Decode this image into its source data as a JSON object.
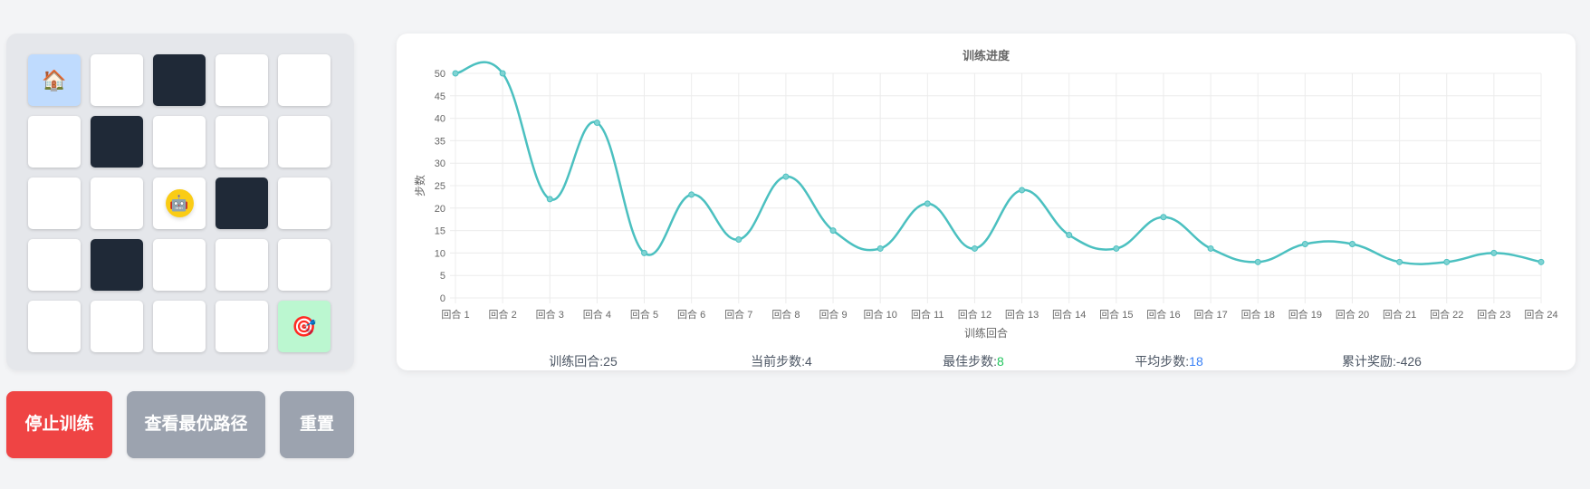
{
  "maze": {
    "rows": [
      [
        "start",
        "empty",
        "wall",
        "empty",
        "empty"
      ],
      [
        "empty",
        "wall",
        "empty",
        "empty",
        "empty"
      ],
      [
        "empty",
        "empty",
        "agent",
        "wall",
        "empty"
      ],
      [
        "empty",
        "wall",
        "empty",
        "empty",
        "empty"
      ],
      [
        "empty",
        "empty",
        "empty",
        "empty",
        "goal"
      ]
    ],
    "icons": {
      "start": "🏠",
      "agent": "🤖",
      "goal": "🎯"
    }
  },
  "buttons": {
    "stop": "停止训练",
    "best_path": "查看最优路径",
    "reset": "重置"
  },
  "chart_data": {
    "type": "line",
    "title": "训练进度",
    "xlabel": "训练回合",
    "ylabel": "步数",
    "categories": [
      "回合 1",
      "回合 2",
      "回合 3",
      "回合 4",
      "回合 5",
      "回合 6",
      "回合 7",
      "回合 8",
      "回合 9",
      "回合 10",
      "回合 11",
      "回合 12",
      "回合 13",
      "回合 14",
      "回合 15",
      "回合 16",
      "回合 17",
      "回合 18",
      "回合 19",
      "回合 20",
      "回合 21",
      "回合 22",
      "回合 23",
      "回合 24"
    ],
    "values": [
      50,
      50,
      22,
      39,
      10,
      23,
      13,
      27,
      15,
      11,
      21,
      11,
      24,
      14,
      11,
      18,
      11,
      8,
      12,
      12,
      8,
      8,
      10,
      8
    ],
    "ylim": [
      0,
      50
    ],
    "yticks": [
      0,
      5,
      10,
      15,
      20,
      25,
      30,
      35,
      40,
      45,
      50
    ],
    "grid": true,
    "color": "#4bc0c0"
  },
  "stats": {
    "episodes_label": "训练回合:",
    "episodes": "25",
    "current_label": "当前步数:",
    "current": "4",
    "best_label": "最佳步数:",
    "best": "8",
    "avg_label": "平均步数:",
    "avg": "18",
    "reward_label": "累计奖励:",
    "reward": "-426"
  }
}
